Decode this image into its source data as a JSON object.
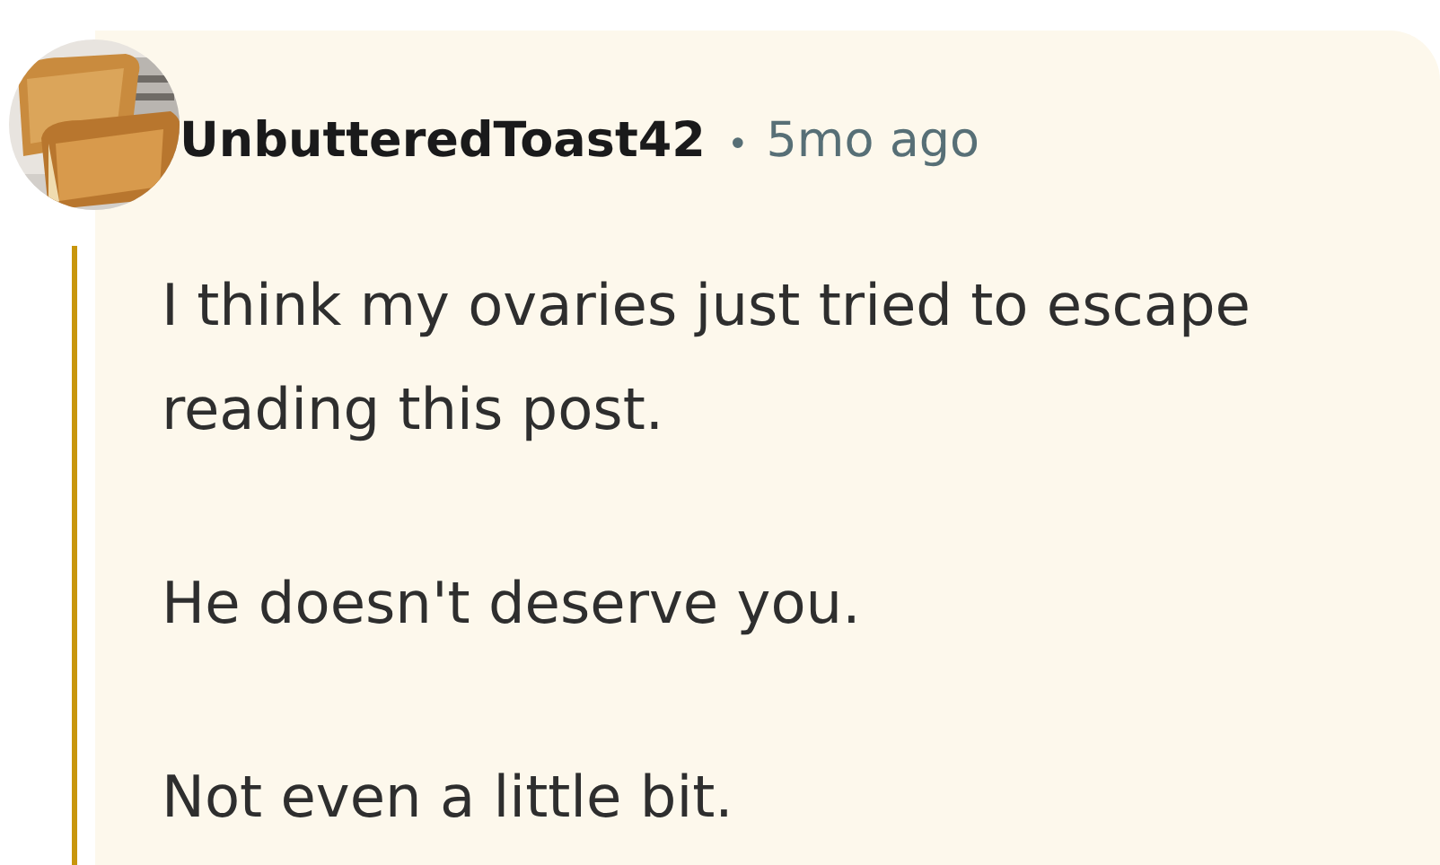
{
  "comment": {
    "author": "UnbutteredToast42",
    "separator": "•",
    "time": "5mo ago",
    "paragraphs": [
      "I think my ovaries just tried to escape reading this post.",
      "He doesn't deserve you.",
      "Not even a little bit."
    ]
  }
}
